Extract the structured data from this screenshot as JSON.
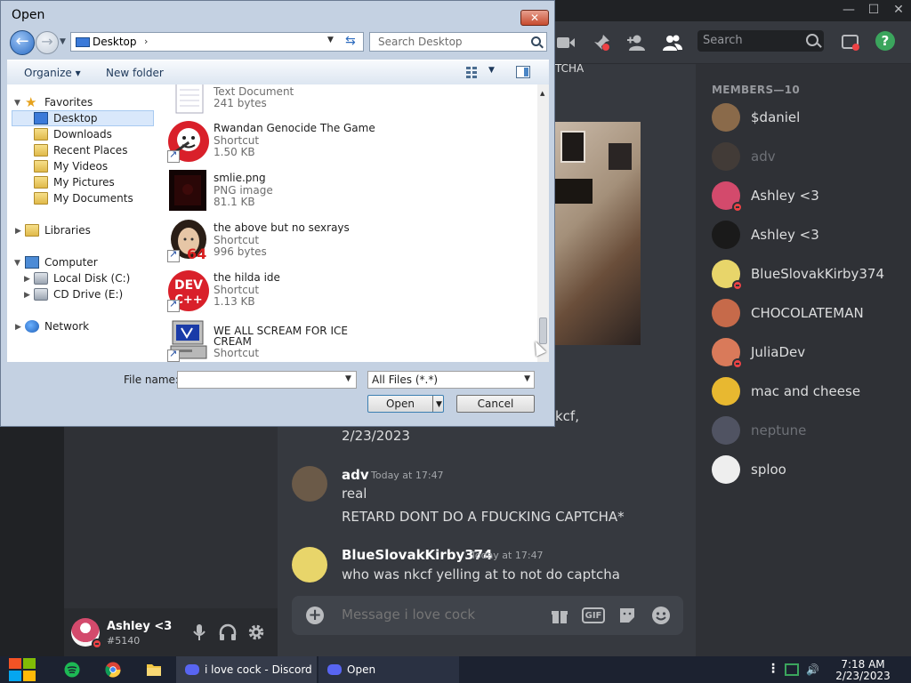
{
  "discord": {
    "window_title": "i love cock - Discord",
    "captcha_fragment": "TCHA",
    "members_header": "MEMBERS—10",
    "members": [
      {
        "name": "$daniel",
        "color": "#8a6a4a",
        "dim": false,
        "dnd": false
      },
      {
        "name": "adv",
        "color": "#5a4a3a",
        "dim": true,
        "dnd": false
      },
      {
        "name": "Ashley <3",
        "color": "#d34a6c",
        "dim": false,
        "dnd": true
      },
      {
        "name": "Ashley <3",
        "color": "#1a1a1a",
        "dim": false,
        "dnd": false
      },
      {
        "name": "BlueSlovakKirby374",
        "color": "#e8d56a",
        "dim": false,
        "dnd": true
      },
      {
        "name": "CHOCOLATEMAN",
        "color": "#c66a4a",
        "dim": false,
        "dnd": false
      },
      {
        "name": "JuliaDev",
        "color": "#d97a5a",
        "dim": false,
        "dnd": true
      },
      {
        "name": "mac and cheese",
        "color": "#e8b830",
        "dim": false,
        "dnd": false
      },
      {
        "name": "neptune",
        "color": "#7a7f9a",
        "dim": true,
        "dnd": false
      },
      {
        "name": "sploo",
        "color": "#eeeeee",
        "dim": false,
        "dnd": false
      }
    ],
    "search_placeholder": "Search",
    "help": "?",
    "frag_user": "kcf,",
    "frag_date": "2/23/2023",
    "messages": [
      {
        "author": "adv",
        "time": "Today at 17:47",
        "lines": [
          "real",
          "RETARD DONT DO A FDUCKING CAPTCHA*"
        ],
        "avatar_color": "#6b5a48"
      },
      {
        "author": "BlueSlovakKirby374",
        "time": "Today at 17:47",
        "lines": [
          "who was nkcf yelling at to not do captcha"
        ],
        "avatar_color": "#e8d56a"
      }
    ],
    "composer_placeholder": "Message i love cock",
    "gif": "GIF",
    "user": {
      "name": "Ashley <3",
      "tag": "#5140"
    }
  },
  "dialog": {
    "title": "Open",
    "close": "✕",
    "address": "Desktop",
    "search_placeholder": "Search Desktop",
    "toolbar": {
      "organize": "Organize ▾",
      "new_folder": "New folder"
    },
    "nav": {
      "favorites": "Favorites",
      "desktop": "Desktop",
      "downloads": "Downloads",
      "recent": "Recent Places",
      "videos": "My Videos",
      "pictures": "My Pictures",
      "documents": "My Documents",
      "libraries": "Libraries",
      "computer": "Computer",
      "local_disk": "Local Disk (C:)",
      "cd_drive": "CD Drive (E:)",
      "network": "Network"
    },
    "files": [
      {
        "name": "Text Document",
        "type": "",
        "size": "241 bytes"
      },
      {
        "name": "Rwandan Genocide The Game",
        "type": "Shortcut",
        "size": "1.50 KB"
      },
      {
        "name": "smlie.png",
        "type": "PNG image",
        "size": "81.1 KB"
      },
      {
        "name": "the above but no sexrays",
        "type": "Shortcut",
        "size": "996 bytes"
      },
      {
        "name": "the hilda ide",
        "type": "Shortcut",
        "size": "1.13 KB"
      },
      {
        "name": "WE ALL SCREAM FOR ICE",
        "name2": "CREAM",
        "type": "Shortcut",
        "size": ""
      }
    ],
    "file_name_label": "File name:",
    "file_name_value": "",
    "file_type": "All Files (*.*)",
    "open_label": "Open",
    "cancel_label": "Cancel",
    "icon_labels": {
      "dev": "DEV",
      "devpp": "C++",
      "n64": "64"
    }
  },
  "taskbar": {
    "discord_task": "i love cock - Discord",
    "open_task": "Open",
    "time": "7:18 AM",
    "date": "2/23/2023"
  }
}
